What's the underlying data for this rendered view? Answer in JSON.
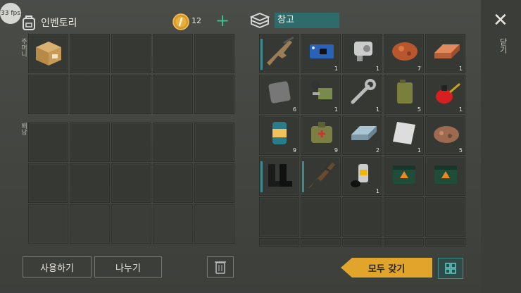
{
  "fps": "33 fps",
  "inventory": {
    "title": "인벤토리",
    "coins": "12",
    "pocket_label": "주머니",
    "backpack_label": "배낭"
  },
  "storage": {
    "title": "창고"
  },
  "buttons": {
    "use": "사용하기",
    "split": "나누기",
    "take_all": "모두 갖기",
    "close": "닫기"
  },
  "colors": {
    "accent_teal": "#2e6c6b",
    "take_all_yellow": "#e0a52a",
    "add_green": "#39c28f"
  },
  "storage_items": [
    {
      "icon": "assault-rifle-icon",
      "qty": ""
    },
    {
      "icon": "circuit-board-icon",
      "qty": "1"
    },
    {
      "icon": "engine-part-icon",
      "qty": "1"
    },
    {
      "icon": "copper-ore-icon",
      "qty": "7"
    },
    {
      "icon": "copper-ingot-icon",
      "qty": "1"
    },
    {
      "icon": "metal-plate-icon",
      "qty": "6"
    },
    {
      "icon": "pipe-parts-icon",
      "qty": "1"
    },
    {
      "icon": "wrench-icon",
      "qty": "1"
    },
    {
      "icon": "jerry-can-icon",
      "qty": "5"
    },
    {
      "icon": "oil-can-icon",
      "qty": "1"
    },
    {
      "icon": "canned-food-icon",
      "qty": "9"
    },
    {
      "icon": "medical-bag-icon",
      "qty": "9"
    },
    {
      "icon": "steel-ingot-icon",
      "qty": "2"
    },
    {
      "icon": "aluminum-sheet-icon",
      "qty": "1"
    },
    {
      "icon": "iron-ore-icon",
      "qty": "5"
    },
    {
      "icon": "boots-icon",
      "qty": ""
    },
    {
      "icon": "ak-rifle-icon",
      "qty": ""
    },
    {
      "icon": "spray-can-icon",
      "qty": "1"
    },
    {
      "icon": "ammo-box-icon",
      "qty": ""
    },
    {
      "icon": "ammo-box-icon",
      "qty": ""
    }
  ],
  "pocket_item": {
    "icon": "cardboard-box-icon"
  }
}
